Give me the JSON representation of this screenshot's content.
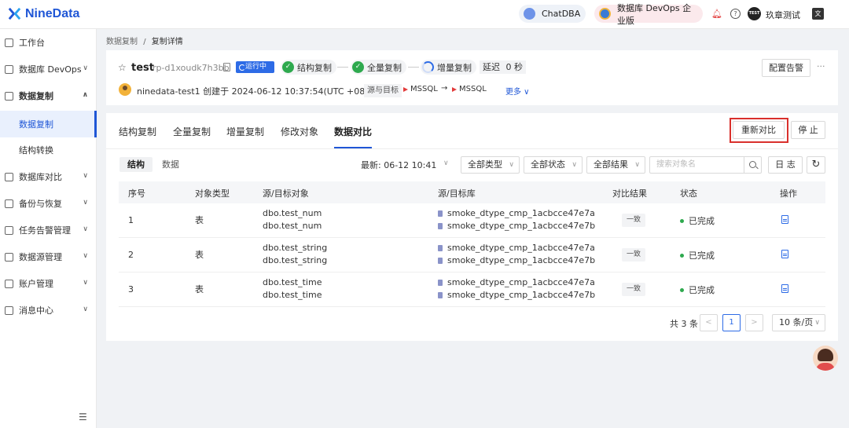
{
  "brand": {
    "name": "NineData"
  },
  "topbar": {
    "chatdba": "ChatDBA",
    "devops": "数据库 DevOps 企业版",
    "avatar_text": "TEST",
    "user": "玖章测试"
  },
  "sidebar": {
    "items": [
      {
        "label": "工作台"
      },
      {
        "label": "数据库 DevOps"
      },
      {
        "label": "数据复制"
      },
      {
        "label": "数据库对比"
      },
      {
        "label": "备份与恢复"
      },
      {
        "label": "任务告警管理"
      },
      {
        "label": "数据源管理"
      },
      {
        "label": "账户管理"
      },
      {
        "label": "消息中心"
      }
    ],
    "sub_items": [
      {
        "label": "数据复制"
      },
      {
        "label": "结构转换"
      }
    ]
  },
  "breadcrumb": {
    "parent": "数据复制",
    "sep": "/",
    "current": "复制详情"
  },
  "task": {
    "name": "test",
    "id": "rp-d1xoudk7h3bb",
    "status": "运行中",
    "stages": [
      "结构复制",
      "全量复制",
      "增量复制"
    ],
    "delay_label": "延迟",
    "delay_value": "0 秒",
    "alert_button": "配置告警",
    "more_dots": "···",
    "creator_line": "ninedata-test1 创建于 2024-06-12 10:37:54(UTC +08:00)",
    "source_target_label": "源与目标",
    "source_db": "MSSQL",
    "arrow": "→",
    "target_db": "MSSQL",
    "more_link": "更多 ∨"
  },
  "tabs": [
    "结构复制",
    "全量复制",
    "增量复制",
    "修改对象",
    "数据对比"
  ],
  "actions": {
    "rediff": "重新对比",
    "stop": "停 止"
  },
  "toolbar": {
    "seg_structure": "结构",
    "seg_data": "数据",
    "latest": "最新: 06-12 10:41",
    "filter_type": "全部类型",
    "filter_status": "全部状态",
    "filter_result": "全部结果",
    "search_placeholder": "搜索对象名",
    "log": "日 志"
  },
  "table": {
    "headers": [
      "序号",
      "对象类型",
      "源/目标对象",
      "源/目标库",
      "对比结果",
      "状态",
      "操作"
    ],
    "rows": [
      {
        "no": "1",
        "type": "表",
        "src_obj": "dbo.test_num",
        "dst_obj": "dbo.test_num",
        "src_db": "smoke_dtype_cmp_1acbcce47e7a",
        "dst_db": "smoke_dtype_cmp_1acbcce47e7b",
        "result": "一致",
        "status": "已完成"
      },
      {
        "no": "2",
        "type": "表",
        "src_obj": "dbo.test_string",
        "dst_obj": "dbo.test_string",
        "src_db": "smoke_dtype_cmp_1acbcce47e7a",
        "dst_db": "smoke_dtype_cmp_1acbcce47e7b",
        "result": "一致",
        "status": "已完成"
      },
      {
        "no": "3",
        "type": "表",
        "src_obj": "dbo.test_time",
        "dst_obj": "dbo.test_time",
        "src_db": "smoke_dtype_cmp_1acbcce47e7a",
        "dst_db": "smoke_dtype_cmp_1acbcce47e7b",
        "result": "一致",
        "status": "已完成"
      }
    ]
  },
  "pagination": {
    "total": "共 3 条",
    "prev": "<",
    "current": "1",
    "next": ">",
    "page_size": "10 条/页"
  },
  "colors": {
    "accent": "#1f56d6",
    "success": "#2ea94e",
    "highlight": "#d9302c"
  }
}
